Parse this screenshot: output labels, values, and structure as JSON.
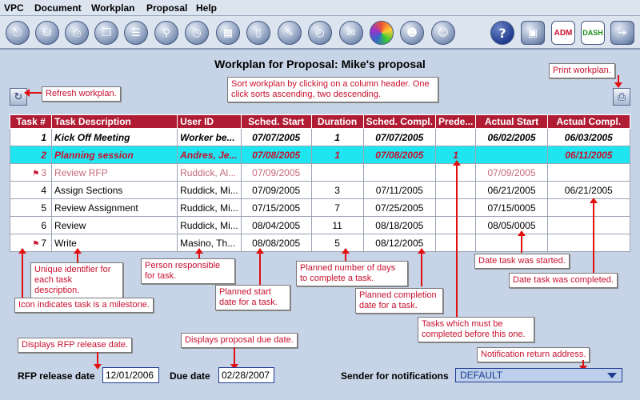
{
  "menu": [
    "VPC",
    "Document",
    "Workplan",
    "Proposal",
    "Help"
  ],
  "toolbar": {
    "help_glyph": "?",
    "adm_label": "ADM",
    "dash_label": "DASH"
  },
  "page_title": "Workplan for Proposal: Mike's proposal",
  "callouts": {
    "refresh": "Refresh workplan.",
    "sort": "Sort workplan by clicking on a column header.  One click sorts ascending, two descending.",
    "print": "Print workplan.",
    "unique_id": "Unique identifier for each task description.",
    "person": "Person responsible for task.",
    "planned_start": "Planned start date for a task.",
    "planned_days": "Planned number of days to complete a task.",
    "planned_completion": "Planned completion date for a task.",
    "date_started": "Date task was started.",
    "date_completed": "Date task was completed.",
    "milestone": "Icon indicates task is a milestone.",
    "predecessors": "Tasks which must be completed before this one.",
    "rfp_release": "Displays RFP release date.",
    "proposal_due": "Displays proposal due date.",
    "notification": "Notification return address."
  },
  "table": {
    "headers": [
      "Task #",
      "Task Description",
      "User ID",
      "Sched. Start",
      "Duration",
      "Sched. Compl.",
      "Prede...",
      "Actual Start",
      "Actual Compl."
    ],
    "rows": [
      {
        "num": "1",
        "desc": "Kick Off Meeting",
        "user": "Worker be...",
        "start": "07/07/2005",
        "dur": "1",
        "compl": "07/07/2005",
        "pred": "",
        "astart": "06/02/2005",
        "acompl": "06/03/2005",
        "milestone": false,
        "style": "bold"
      },
      {
        "num": "2",
        "desc": "Planning session",
        "user": "Andres, Je...",
        "start": "07/08/2005",
        "dur": "1",
        "compl": "07/08/2005",
        "pred": "1",
        "astart": "",
        "acompl": "06/11/2005",
        "milestone": false,
        "style": "hl"
      },
      {
        "num": "3",
        "desc": "Review RFP",
        "user": "Ruddick, Al...",
        "start": "07/09/2005",
        "dur": "",
        "compl": "",
        "pred": "",
        "astart": "07/09/2005",
        "acompl": "",
        "milestone": true,
        "style": "pink"
      },
      {
        "num": "4",
        "desc": "Assign Sections",
        "user": "Ruddick, Mi...",
        "start": "07/09/2005",
        "dur": "3",
        "compl": "07/11/2005",
        "pred": "",
        "astart": "06/21/2005",
        "acompl": "06/21/2005",
        "milestone": false,
        "style": ""
      },
      {
        "num": "5",
        "desc": "Review Assignment",
        "user": "Ruddick, Mi...",
        "start": "07/15/2005",
        "dur": "7",
        "compl": "07/25/2005",
        "pred": "",
        "astart": "07/15/0005",
        "acompl": "",
        "milestone": false,
        "style": ""
      },
      {
        "num": "6",
        "desc": "Review",
        "user": "Ruddick, Mi...",
        "start": "08/04/2005",
        "dur": "11",
        "compl": "08/18/2005",
        "pred": "",
        "astart": "08/05/0005",
        "acompl": "",
        "milestone": false,
        "style": ""
      },
      {
        "num": "7",
        "desc": "Write",
        "user": "Masino, Th...",
        "start": "08/08/2005",
        "dur": "5",
        "compl": "08/12/2005",
        "pred": "",
        "astart": "",
        "acompl": "",
        "milestone": true,
        "style": ""
      }
    ]
  },
  "footer": {
    "rfp_label": "RFP release date",
    "rfp_value": "12/01/2006",
    "due_label": "Due date",
    "due_value": "02/28/2007",
    "sender_label": "Sender for notifications",
    "sender_value": "DEFAULT"
  }
}
